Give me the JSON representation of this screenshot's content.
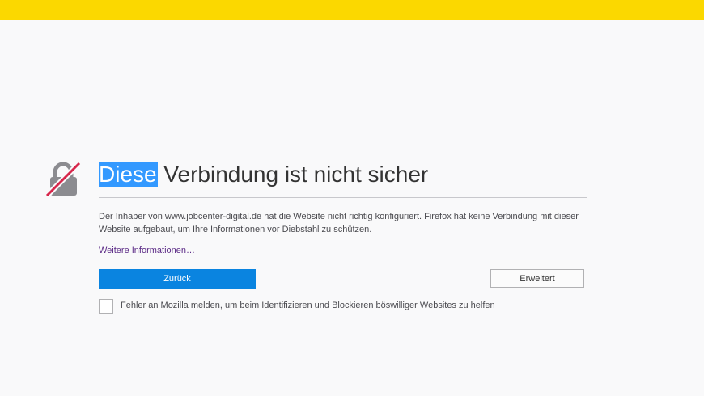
{
  "colors": {
    "top_bar": "#fbd800",
    "primary_button": "#0a84e0",
    "link": "#5b2a86"
  },
  "icons": {
    "warning": "broken-lock-icon"
  },
  "heading": {
    "highlighted": "Diese",
    "rest": " Verbindung ist nicht sicher"
  },
  "description": "Der Inhaber von www.jobcenter-digital.de hat die Website nicht richtig konfiguriert. Firefox hat keine Verbindung mit dieser Website aufgebaut, um Ihre Informationen vor Diebstahl zu schützen.",
  "more_info_link": "Weitere Informationen…",
  "buttons": {
    "back": "Zurück",
    "advanced": "Erweitert"
  },
  "report": {
    "label": "Fehler an Mozilla melden, um beim Identifizieren und Blockieren böswilliger Websites zu helfen",
    "checked": false
  }
}
